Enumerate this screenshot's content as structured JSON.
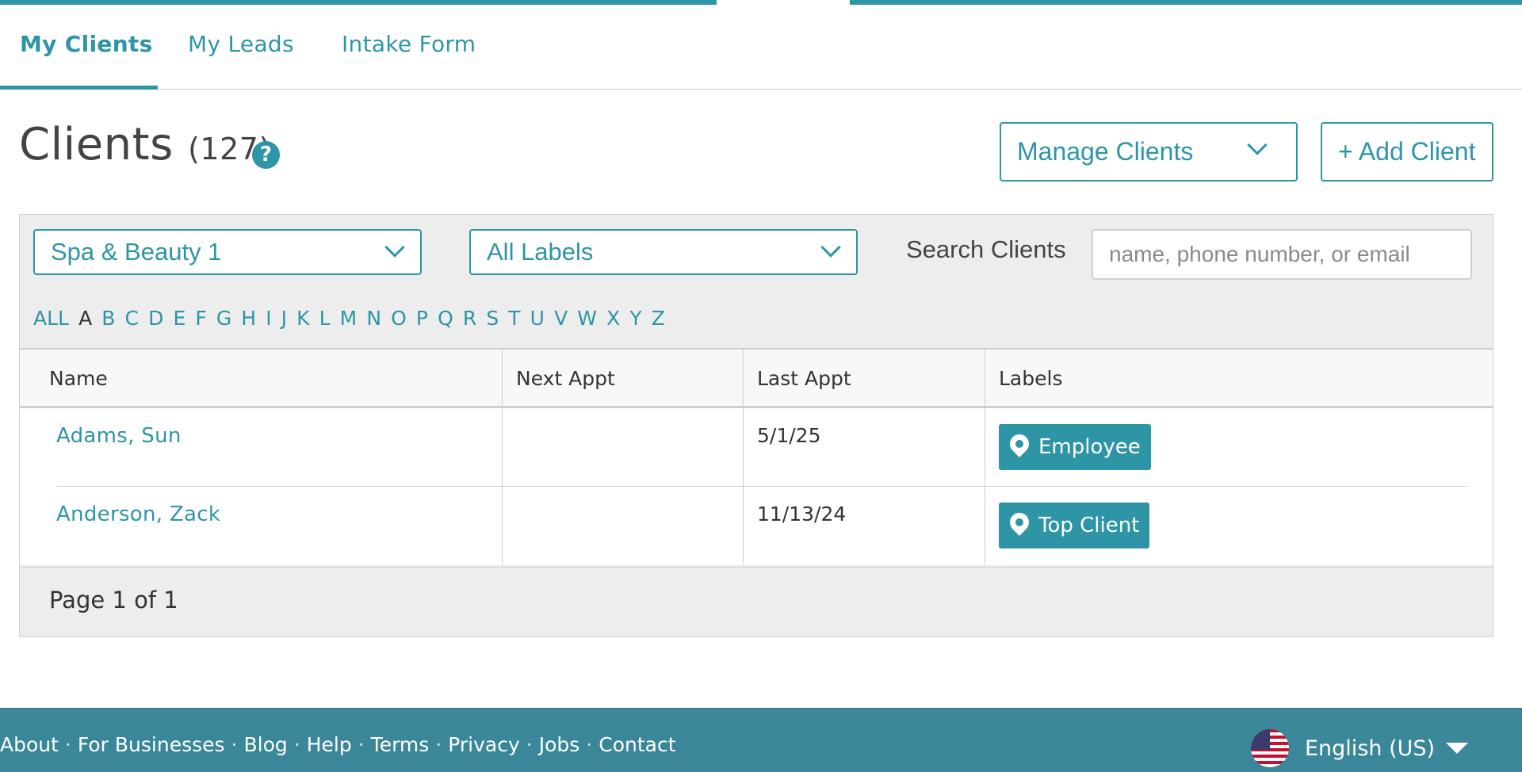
{
  "tabs": [
    {
      "label": "My Clients",
      "active": true
    },
    {
      "label": "My Leads",
      "active": false
    },
    {
      "label": "Intake Form",
      "active": false
    }
  ],
  "header": {
    "title": "Clients",
    "count": "(127)",
    "help_icon": "?",
    "manage_button": "Manage Clients",
    "add_button": "+ Add Client"
  },
  "filters": {
    "venue_selected": "Spa & Beauty 1",
    "labels_selected": "All Labels",
    "search_label": "Search Clients",
    "search_placeholder": "name, phone number, or email",
    "search_value": ""
  },
  "alphabet": {
    "items": [
      "ALL",
      "A",
      "B",
      "C",
      "D",
      "E",
      "F",
      "G",
      "H",
      "I",
      "J",
      "K",
      "L",
      "M",
      "N",
      "O",
      "P",
      "Q",
      "R",
      "S",
      "T",
      "U",
      "V",
      "W",
      "X",
      "Y",
      "Z"
    ],
    "selected": "A"
  },
  "table": {
    "columns": [
      "Name",
      "Next Appt",
      "Last Appt",
      "Labels"
    ],
    "rows": [
      {
        "name": "Adams, Sun",
        "next_appt": "",
        "last_appt": "5/1/25",
        "label": "Employee"
      },
      {
        "name": "Anderson, Zack",
        "next_appt": "",
        "last_appt": "11/13/24",
        "label": "Top Client"
      }
    ]
  },
  "pager": {
    "text": "Page 1 of 1"
  },
  "footer": {
    "links": [
      "About",
      "For Businesses",
      "Blog",
      "Help",
      "Terms",
      "Privacy",
      "Jobs",
      "Contact"
    ],
    "language": "English (US)"
  },
  "colors": {
    "accent": "#2e95a7",
    "footer_bg": "#3a8799",
    "panel_bg": "#ededed"
  },
  "icons": {
    "help": "question-circle-icon",
    "chevron": "chevron-down-icon",
    "label": "map-pin-icon",
    "flag": "us-flag-icon",
    "caret": "caret-down-icon"
  }
}
